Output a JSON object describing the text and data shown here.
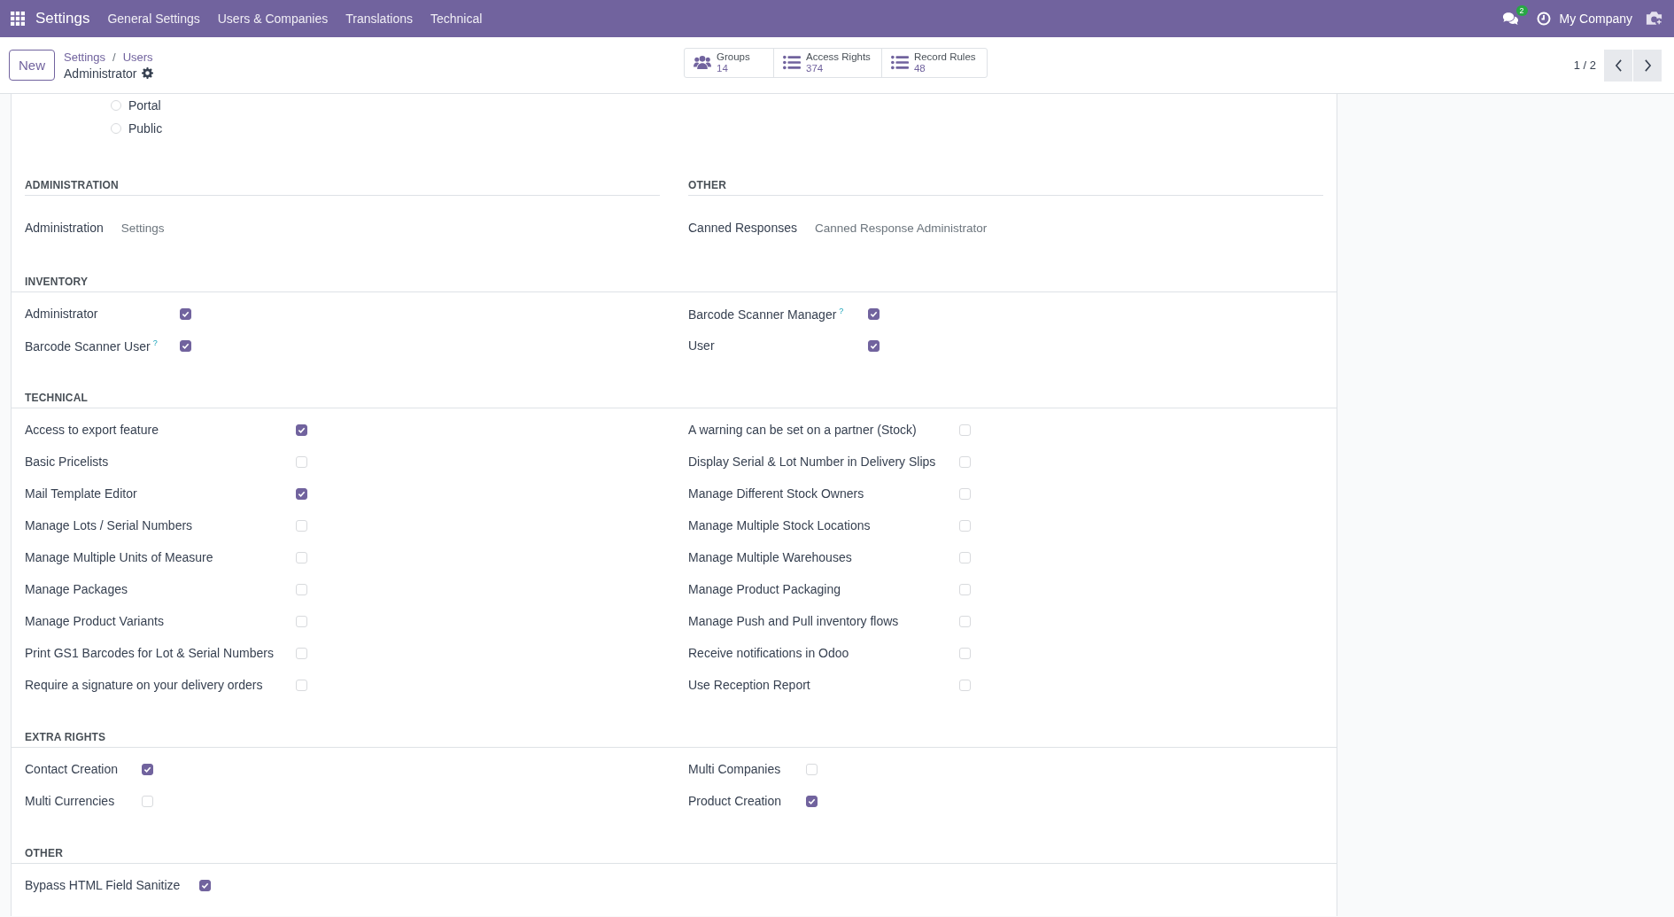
{
  "navbar": {
    "app": "Settings",
    "menu": [
      "General Settings",
      "Users & Companies",
      "Translations",
      "Technical"
    ],
    "messages_badge": "2",
    "company": "My Company"
  },
  "control_panel": {
    "new_button": "New",
    "breadcrumb": [
      "Settings",
      "Users"
    ],
    "record": "Administrator",
    "stat_buttons": [
      {
        "label": "Groups",
        "value": "14",
        "kind": "users"
      },
      {
        "label": "Access Rights",
        "value": "374",
        "kind": "rules"
      },
      {
        "label": "Record Rules",
        "value": "48",
        "kind": "rules"
      }
    ],
    "pager": "1 / 2",
    "separator": "/"
  },
  "user_types": [
    {
      "label": "Portal",
      "selected": false
    },
    {
      "label": "Public",
      "selected": false
    }
  ],
  "select_groups": [
    {
      "title": "ADMINISTRATION",
      "field": "Administration",
      "value": "Settings"
    },
    {
      "title": "OTHER",
      "field": "Canned Responses",
      "value": "Canned Response Administrator"
    }
  ],
  "sections": [
    {
      "title": "INVENTORY",
      "columns": [
        [
          {
            "label": "Administrator",
            "checked": true
          },
          {
            "label": "Barcode Scanner User",
            "help": "?",
            "checked": true
          }
        ],
        [
          {
            "label": "Barcode Scanner Manager",
            "help": "?",
            "checked": true
          },
          {
            "label": "User",
            "checked": true
          }
        ]
      ]
    },
    {
      "title": "TECHNICAL",
      "columns": [
        [
          {
            "label": "Access to export feature",
            "checked": true
          },
          {
            "label": "Basic Pricelists",
            "checked": false
          },
          {
            "label": "Mail Template Editor",
            "checked": true
          },
          {
            "label": "Manage Lots / Serial Numbers",
            "checked": false
          },
          {
            "label": "Manage Multiple Units of Measure",
            "checked": false
          },
          {
            "label": "Manage Packages",
            "checked": false
          },
          {
            "label": "Manage Product Variants",
            "checked": false
          },
          {
            "label": "Print GS1 Barcodes for Lot & Serial Numbers",
            "checked": false
          },
          {
            "label": "Require a signature on your delivery orders",
            "checked": false
          }
        ],
        [
          {
            "label": "A warning can be set on a partner (Stock)",
            "checked": false
          },
          {
            "label": "Display Serial & Lot Number in Delivery Slips",
            "checked": false
          },
          {
            "label": "Manage Different Stock Owners",
            "checked": false
          },
          {
            "label": "Manage Multiple Stock Locations",
            "checked": false
          },
          {
            "label": "Manage Multiple Warehouses",
            "checked": false
          },
          {
            "label": "Manage Product Packaging",
            "checked": false
          },
          {
            "label": "Manage Push and Pull inventory flows",
            "checked": false
          },
          {
            "label": "Receive notifications in Odoo",
            "checked": false
          },
          {
            "label": "Use Reception Report",
            "checked": false
          }
        ]
      ]
    },
    {
      "title": "EXTRA RIGHTS",
      "columns": [
        [
          {
            "label": "Contact Creation",
            "checked": true
          },
          {
            "label": "Multi Currencies",
            "checked": false
          }
        ],
        [
          {
            "label": "Multi Companies",
            "checked": false
          },
          {
            "label": "Product Creation",
            "checked": true
          }
        ]
      ]
    },
    {
      "title": "OTHER",
      "columns": [
        [
          {
            "label": "Bypass HTML Field Sanitize",
            "checked": true
          }
        ]
      ]
    }
  ]
}
